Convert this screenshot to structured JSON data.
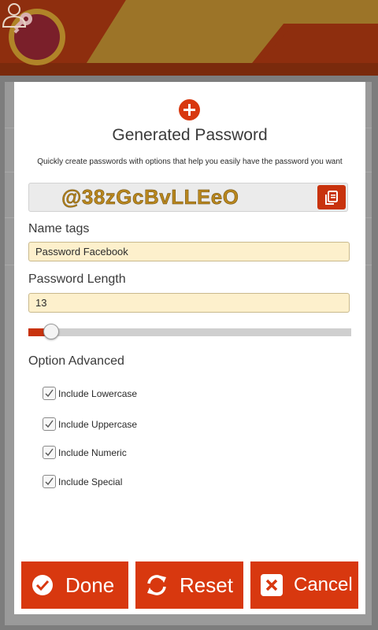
{
  "header": {
    "logo_icon": "key-icon",
    "user_icon": "user-icon",
    "colors": {
      "dark": "#8e2e0e",
      "stripe": "#b08428"
    }
  },
  "modal": {
    "add_icon": "plus-icon",
    "title": "Generated Password",
    "subtitle": "Quickly create passwords with options that help you easily have the password you want",
    "password": "@38zGcBvLLEeO",
    "copy_icon": "copy-icon",
    "name_tags": {
      "label": "Name tags",
      "value": "Password Facebook"
    },
    "length": {
      "label": "Password Length",
      "value": "13",
      "slider_fraction": 0.07
    },
    "advanced": {
      "label": "Option Advanced",
      "options": [
        {
          "label": "Include Lowercase",
          "checked": true
        },
        {
          "label": "Include Uppercase",
          "checked": true
        },
        {
          "label": "Include Numeric",
          "checked": true
        },
        {
          "label": "Include Special",
          "checked": true
        }
      ]
    }
  },
  "buttons": {
    "done": {
      "label": "Done",
      "icon": "check-circle-icon"
    },
    "reset": {
      "label": "Reset",
      "icon": "refresh-icon"
    },
    "cancel": {
      "label": "Cancel",
      "icon": "close-box-icon"
    }
  },
  "colors": {
    "accent": "#d8380f",
    "input_bg": "#fdf0cc",
    "password_text": "#b8861d"
  }
}
